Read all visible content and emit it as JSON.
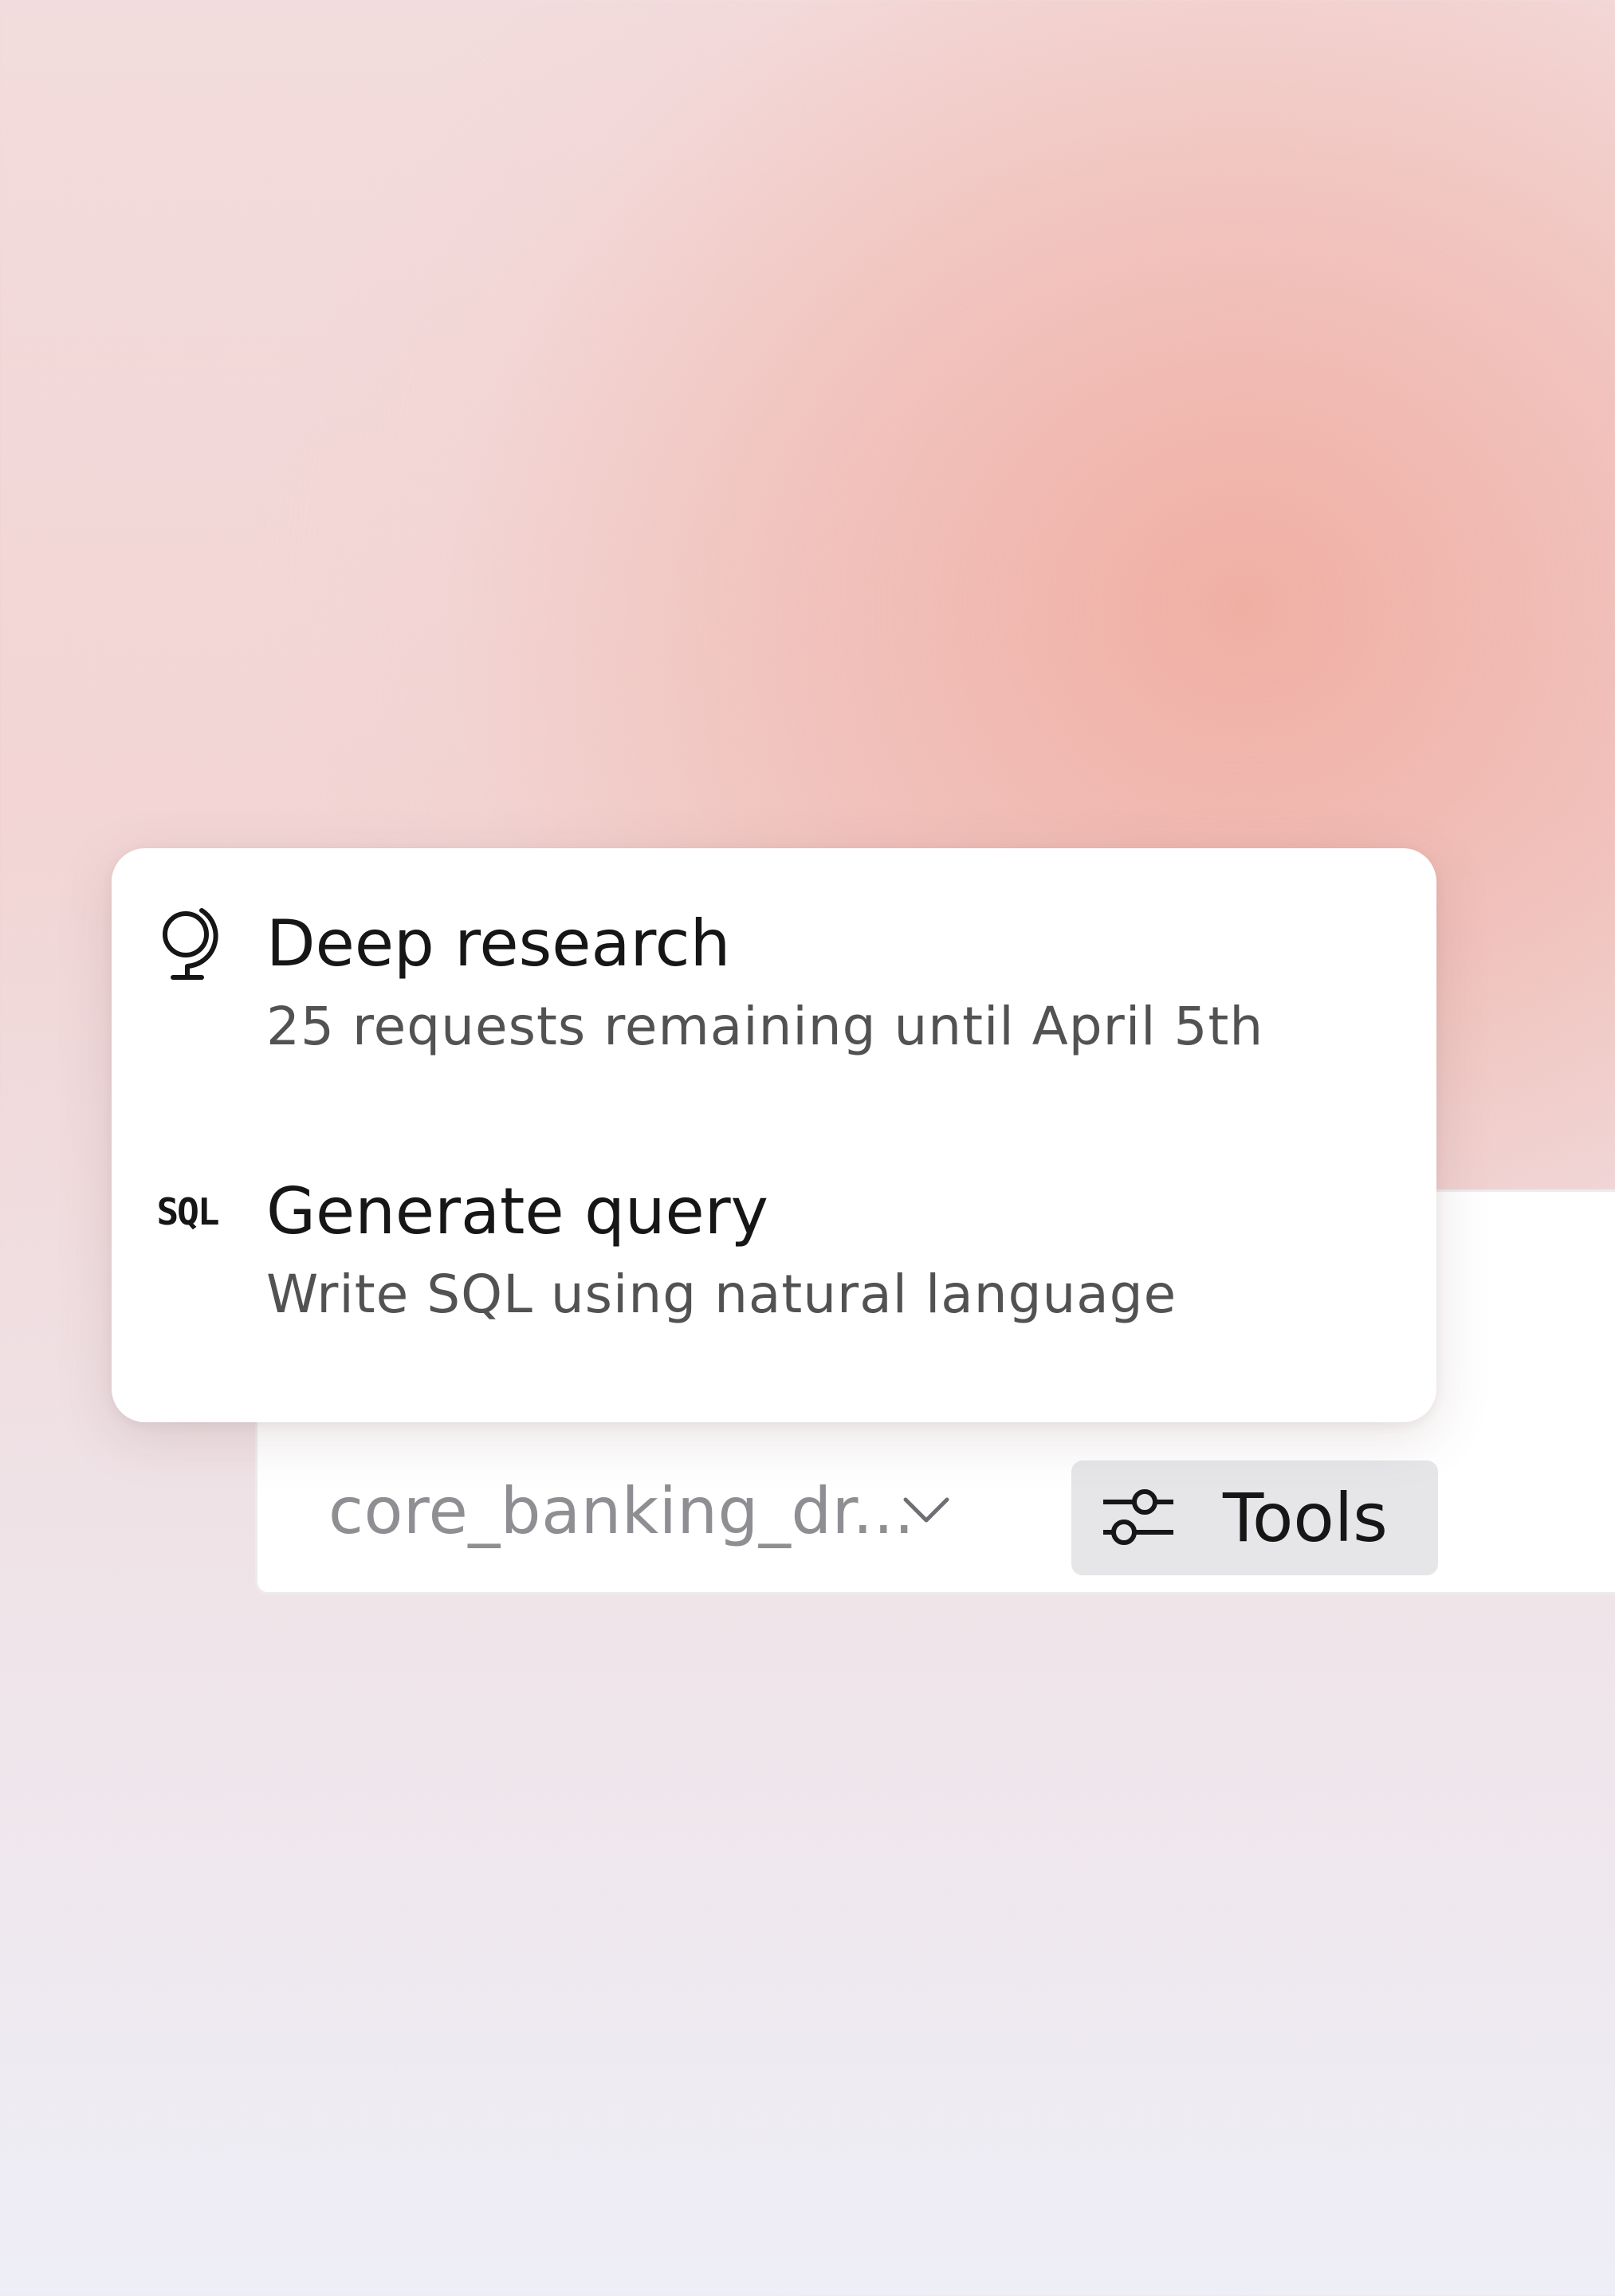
{
  "composer": {
    "database_selector": {
      "value": "core_banking_dr...",
      "icon": "chevron-down-icon"
    },
    "tools_button": {
      "label": "Tools",
      "icon": "sliders-icon"
    }
  },
  "tools_menu": {
    "items": [
      {
        "icon": "globe-icon",
        "title": "Deep research",
        "subtitle": "25 requests remaining until April 5th"
      },
      {
        "icon": "sql-icon",
        "icon_text": "SQL",
        "title": "Generate query",
        "subtitle": "Write SQL using natural language"
      }
    ]
  },
  "colors": {
    "background_gradient": "#f2c1b8",
    "menu_background": "#ffffff",
    "tools_button_background": "#e6e6e8",
    "text_primary": "#161616",
    "text_secondary": "#525252",
    "text_placeholder": "#8f8f93"
  }
}
